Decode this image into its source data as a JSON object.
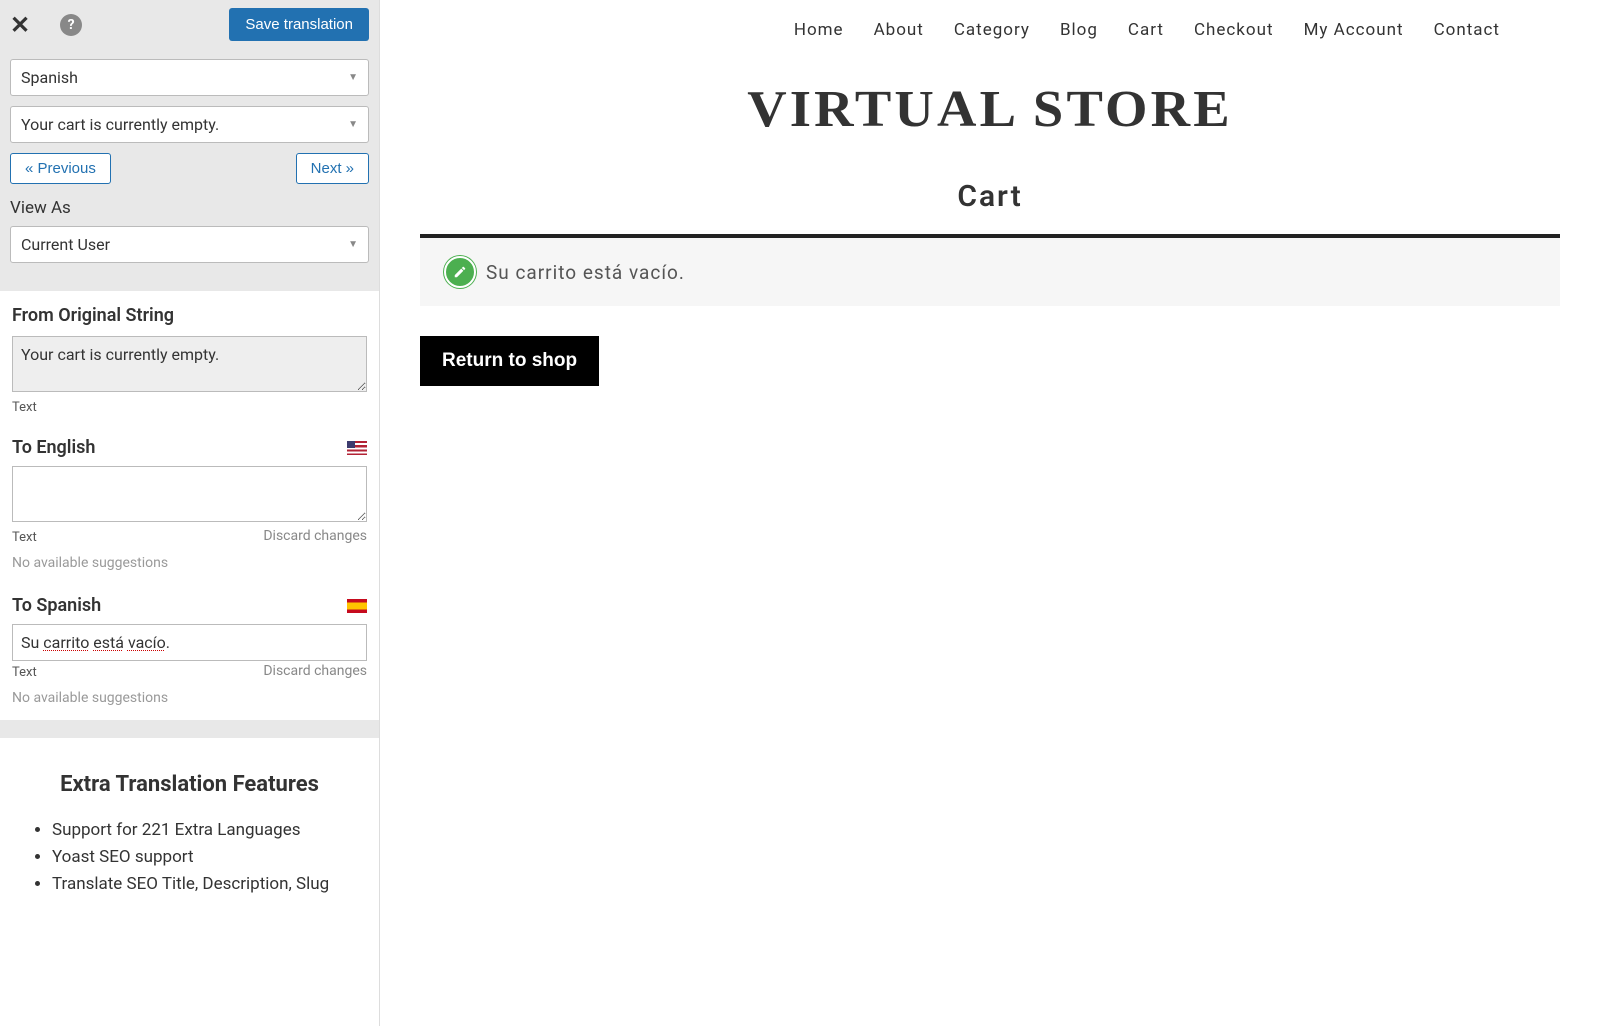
{
  "topbar": {
    "save": "Save translation"
  },
  "langDropdown": {
    "value": "Spanish"
  },
  "stringDropdown": {
    "value": "Your cart is currently empty."
  },
  "nav": {
    "prev": "« Previous",
    "next": "Next »"
  },
  "viewAs": {
    "label": "View As",
    "value": "Current User"
  },
  "original": {
    "heading": "From Original String",
    "value": "Your cart is currently empty.",
    "sub": "Text"
  },
  "english": {
    "heading": "To English",
    "value": "",
    "sub": "Text",
    "discard": "Discard changes",
    "suggestion": "No available suggestions"
  },
  "spanish": {
    "heading": "To Spanish",
    "value_pre": "Su ",
    "value_w1": "carrito",
    "value_sp1": " ",
    "value_w2": "está",
    "value_sp2": " ",
    "value_w3": "vacío",
    "value_post": ".",
    "full": "Su carrito está vacío.",
    "sub": "Text",
    "discard": "Discard changes",
    "suggestion": "No available suggestions"
  },
  "extra": {
    "heading": "Extra Translation Features",
    "items": [
      "Support for 221 Extra Languages",
      "Yoast SEO support",
      "Translate SEO Title, Description, Slug"
    ]
  },
  "preview": {
    "menu": [
      "Home",
      "About",
      "Category",
      "Blog",
      "Cart",
      "Checkout",
      "My Account",
      "Contact"
    ],
    "storeTitle": "VIRTUAL STORE",
    "pageTitle": "Cart",
    "cartMsg": "Su carrito está vacío.",
    "returnBtn": "Return to shop"
  }
}
